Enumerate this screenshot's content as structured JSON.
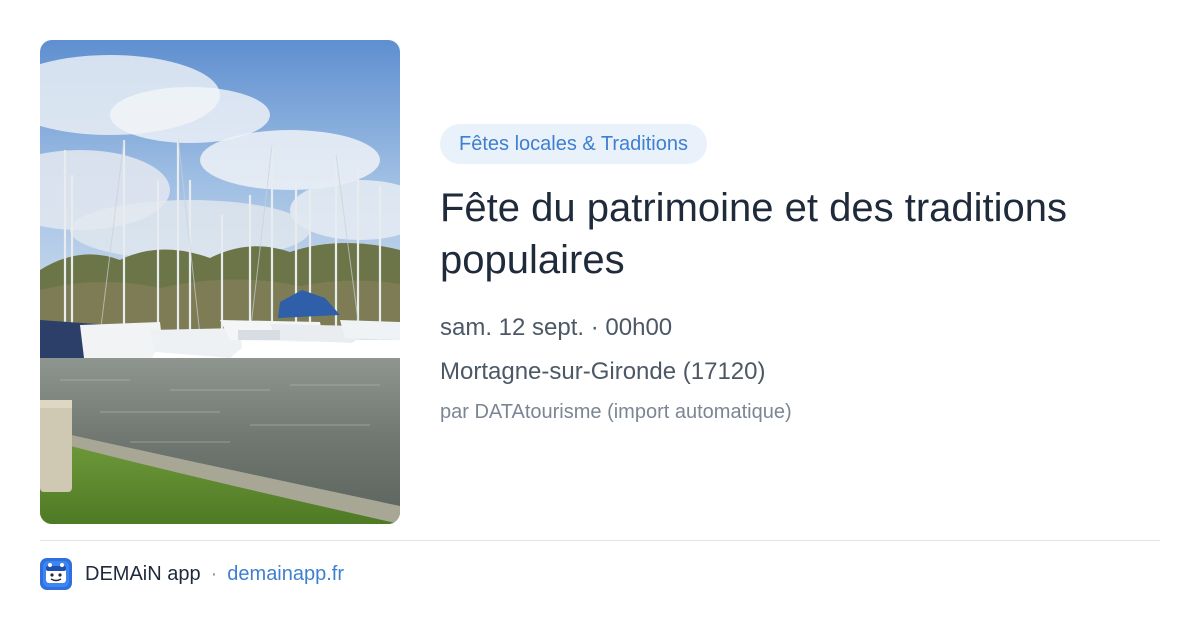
{
  "event": {
    "category": "Fêtes locales & Traditions",
    "title": "Fête du patrimoine et des traditions populaires",
    "datetime": "sam. 12 sept. · 00h00",
    "location": "Mortagne-sur-Gironde (17120)",
    "author": "par DATAtourisme (import automatique)",
    "image_alt": "Port de plaisance avec voiliers sous un ciel bleu"
  },
  "footer": {
    "app_name": "DEMAiN app",
    "separator": "·",
    "domain": "demainapp.fr",
    "icon": "demain-app-logo-icon"
  },
  "colors": {
    "accent": "#3f7fcf",
    "chip_background": "#e9f1fb",
    "title": "#1f2a3a",
    "meta": "#4d5866",
    "muted": "#7b8694",
    "divider": "#dde3ea"
  }
}
